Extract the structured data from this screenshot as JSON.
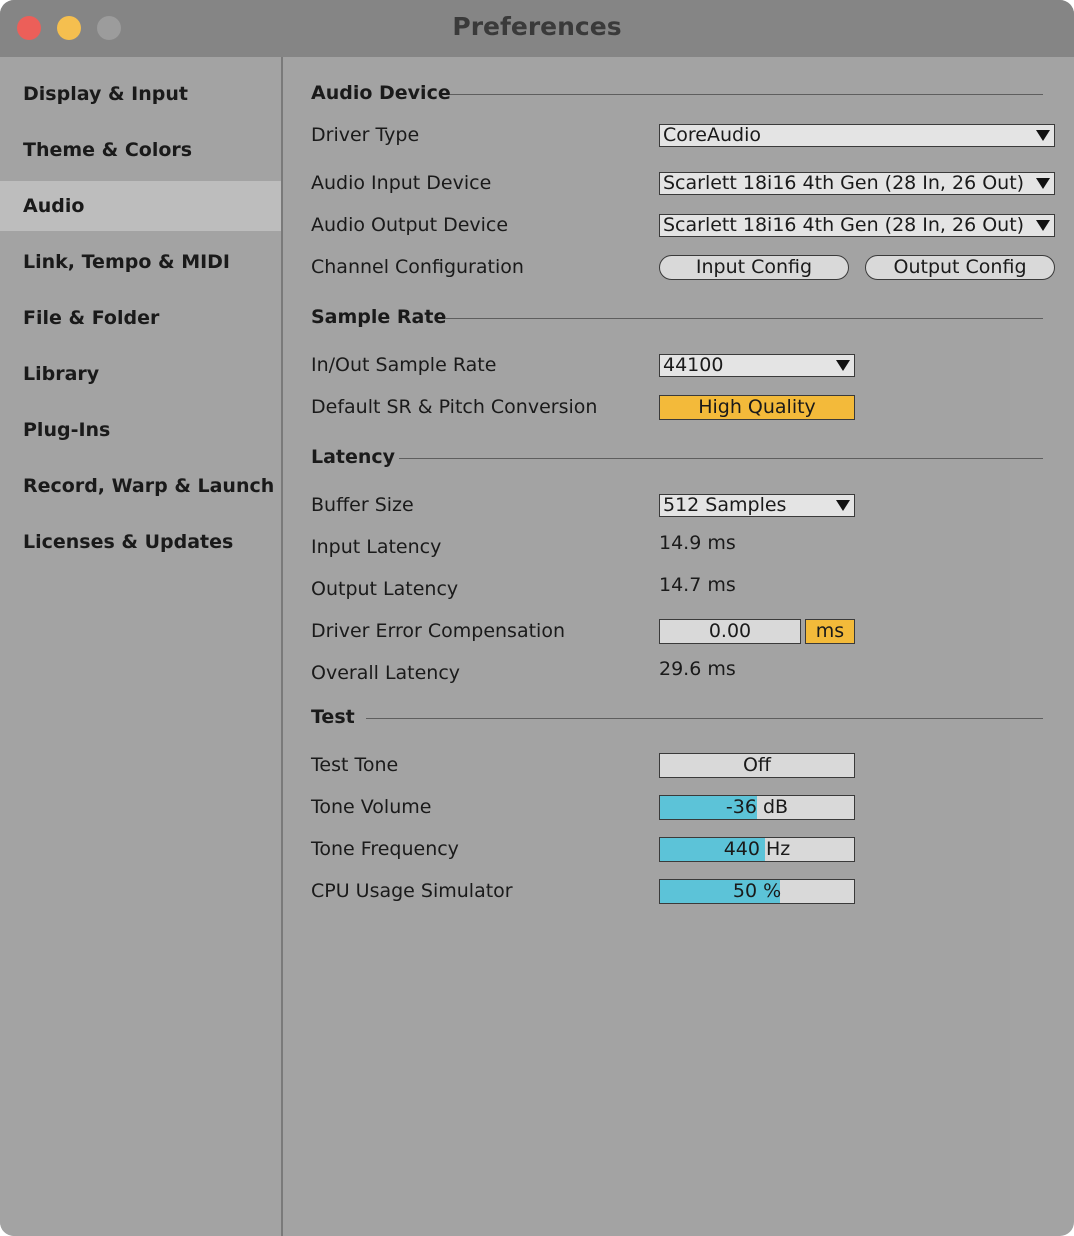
{
  "window": {
    "title": "Preferences"
  },
  "sidebar": {
    "items": [
      {
        "label": "Display & Input"
      },
      {
        "label": "Theme & Colors"
      },
      {
        "label": "Audio",
        "active": true
      },
      {
        "label": "Link, Tempo & MIDI"
      },
      {
        "label": "File & Folder"
      },
      {
        "label": "Library"
      },
      {
        "label": "Plug-Ins"
      },
      {
        "label": "Record, Warp & Launch"
      },
      {
        "label": "Licenses & Updates"
      }
    ]
  },
  "audio_device": {
    "heading": "Audio Device",
    "driver_type_label": "Driver Type",
    "driver_type_value": "CoreAudio",
    "input_device_label": "Audio Input Device",
    "input_device_value": "Scarlett 18i16 4th Gen (28 In, 26 Out)",
    "output_device_label": "Audio Output Device",
    "output_device_value": "Scarlett 18i16 4th Gen (28 In, 26 Out)",
    "channel_config_label": "Channel Configuration",
    "input_config_button": "Input Config",
    "output_config_button": "Output Config"
  },
  "sample_rate": {
    "heading": "Sample Rate",
    "rate_label": "In/Out Sample Rate",
    "rate_value": "44100",
    "conversion_label": "Default SR & Pitch Conversion",
    "conversion_value": "High Quality"
  },
  "latency": {
    "heading": "Latency",
    "buffer_label": "Buffer Size",
    "buffer_value": "512 Samples",
    "input_latency_label": "Input Latency",
    "input_latency_value": "14.9 ms",
    "output_latency_label": "Output Latency",
    "output_latency_value": "14.7 ms",
    "driver_comp_label": "Driver Error Compensation",
    "driver_comp_value": "0.00",
    "driver_comp_unit": "ms",
    "overall_label": "Overall Latency",
    "overall_value": "29.6 ms"
  },
  "test": {
    "heading": "Test",
    "tone_label": "Test Tone",
    "tone_value": "Off",
    "volume_label": "Tone Volume",
    "volume_value": "-36 dB",
    "volume_level": 0.5,
    "frequency_label": "Tone Frequency",
    "frequency_value": "440 Hz",
    "frequency_level": 0.54,
    "cpu_label": "CPU Usage Simulator",
    "cpu_value": "50 %",
    "cpu_level": 0.62
  },
  "colors": {
    "accent_yellow": "#f3ba3a",
    "slider_fill": "#5cc3d8",
    "close": "#ec5f59",
    "minimize": "#f5bf4f"
  }
}
